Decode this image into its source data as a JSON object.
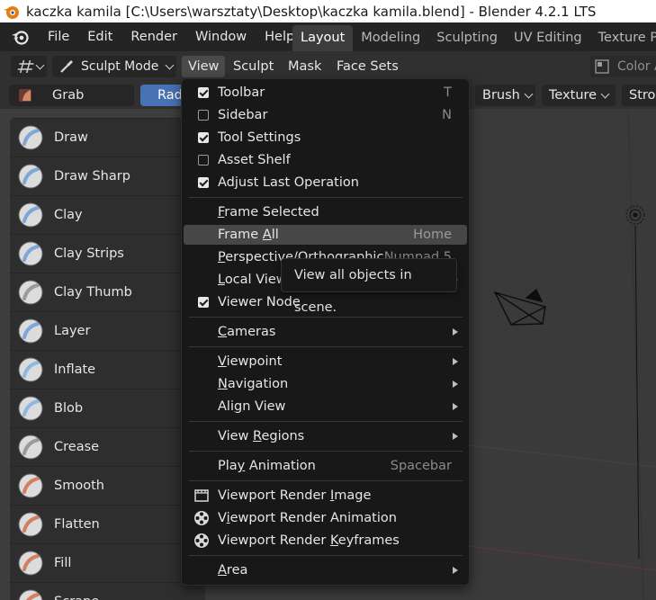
{
  "window": {
    "title": "kaczka kamila [C:\\Users\\warsztaty\\Desktop\\kaczka kamila.blend] - Blender 4.2.1 LTS"
  },
  "topmenu": {
    "items": [
      "File",
      "Edit",
      "Render",
      "Window",
      "Help"
    ]
  },
  "workspaces": {
    "tabs": [
      "Layout",
      "Modeling",
      "Sculpting",
      "UV Editing",
      "Texture P"
    ]
  },
  "header": {
    "mode": "Sculpt Mode",
    "menus": [
      "View",
      "Sculpt",
      "Mask",
      "Face Sets"
    ],
    "right_label": "Color A"
  },
  "tool_settings": {
    "brush_name": "Grab",
    "radius_label": "Rad",
    "brush_menu": "Brush",
    "texture_menu": "Texture",
    "stroke_menu": "Strok"
  },
  "tools": [
    "Draw",
    "Draw Sharp",
    "Clay",
    "Clay Strips",
    "Clay Thumb",
    "Layer",
    "Inflate",
    "Blob",
    "Crease",
    "Smooth",
    "Flatten",
    "Fill",
    "Scrape"
  ],
  "view_menu": {
    "toolbar": "Toolbar",
    "toolbar_shortcut": "T",
    "sidebar": "Sidebar",
    "sidebar_shortcut": "N",
    "tool_settings": "Tool Settings",
    "asset_shelf": "Asset Shelf",
    "adjust_last_operation": "Adjust Last Operation",
    "frame_selected": "Frame Selected",
    "frame_all": "Frame All",
    "frame_all_shortcut": "Home",
    "perspective": "Perspective/Orthographic",
    "perspective_shortcut": "Numpad 5",
    "local_view": "Local View",
    "viewer_node": "Viewer Node",
    "cameras": "Cameras",
    "viewpoint": "Viewpoint",
    "navigation": "Navigation",
    "align_view": "Align View",
    "view_regions": "View Regions",
    "play_animation": "Play Animation",
    "play_animation_shortcut": "Spacebar",
    "render_image": "Viewport Render Image",
    "render_animation": "Viewport Render Animation",
    "render_keyframes": "Viewport Render Keyframes",
    "area": "Area"
  },
  "tooltip": {
    "text": "View all objects in scene."
  },
  "colors": {
    "accent": "#4772b3",
    "menu_bg": "#181818",
    "highlight": "#474747"
  }
}
